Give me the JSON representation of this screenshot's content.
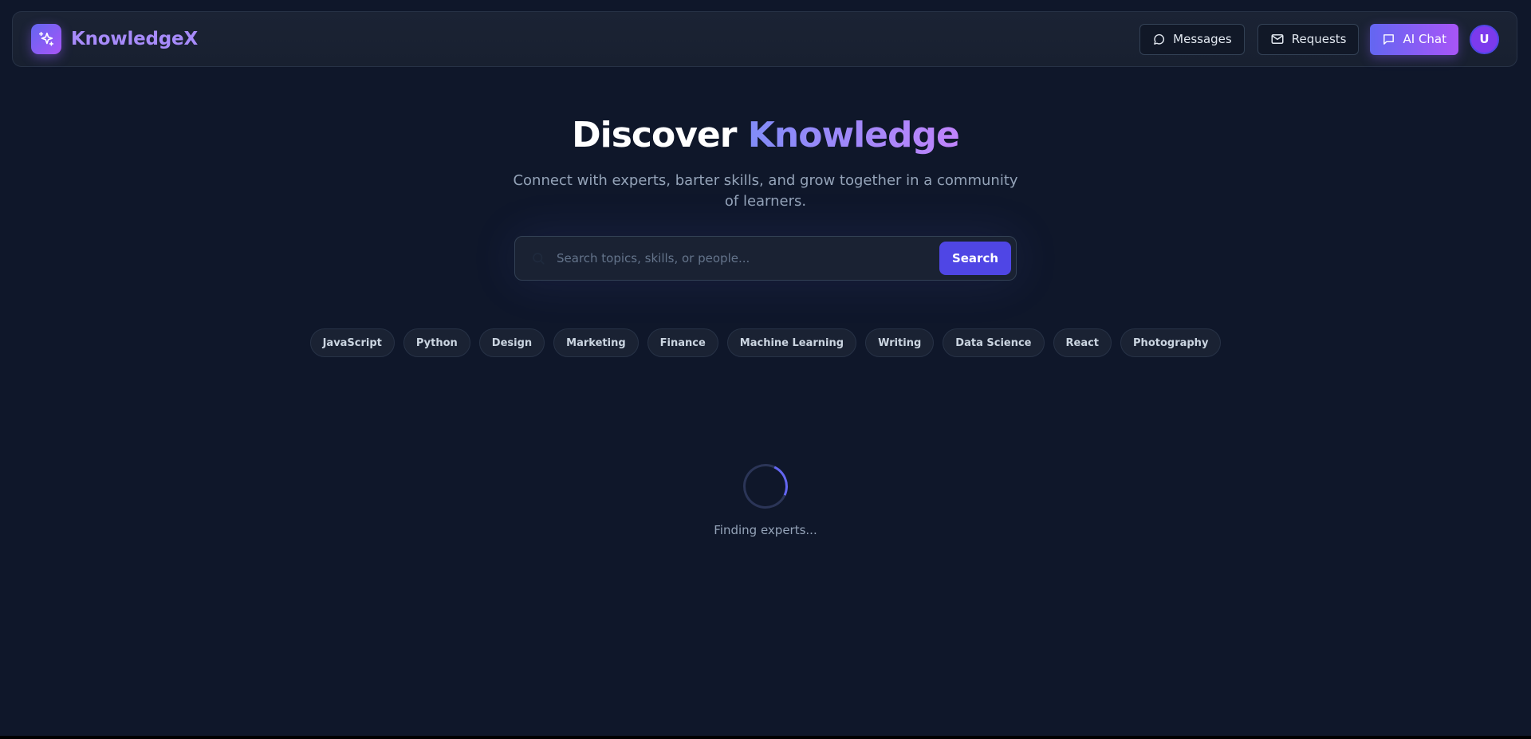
{
  "brand": {
    "name": "KnowledgeX",
    "logo_icon": "sparkles-icon",
    "accent": "#a78bfa"
  },
  "nav": {
    "messages_label": "Messages",
    "requests_label": "Requests",
    "ai_chat_label": "AI Chat",
    "avatar_initial": "U"
  },
  "hero": {
    "title_part1": "Discover",
    "title_part2": "Knowledge",
    "subtitle": "Connect with experts, barter skills, and grow together in a community of learners."
  },
  "search": {
    "placeholder": "Search topics, skills, or people...",
    "value": "",
    "button_label": "Search"
  },
  "tags": [
    "JavaScript",
    "Python",
    "Design",
    "Marketing",
    "Finance",
    "Machine Learning",
    "Writing",
    "Data Science",
    "React",
    "Photography"
  ],
  "loading": {
    "text": "Finding experts..."
  },
  "colors": {
    "background": "#0f172a",
    "primary": "#4f46e5",
    "gradient_start": "#6366f1",
    "gradient_end": "#a855f7"
  }
}
